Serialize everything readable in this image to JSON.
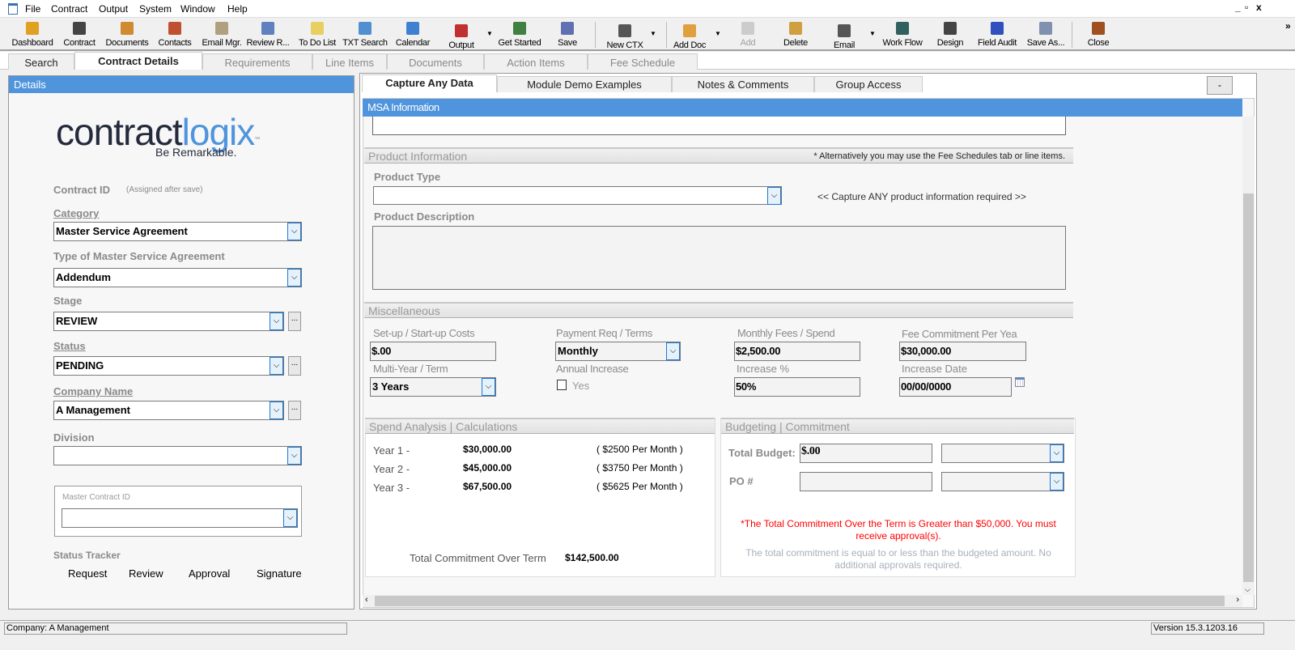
{
  "menu": [
    "File",
    "Contract",
    "Output",
    "System",
    "Window",
    "Help"
  ],
  "window_controls": {
    "minimize": "_",
    "restore": "▫",
    "close": "x",
    "overflow": "»"
  },
  "toolbar": [
    {
      "label": "Dashboard",
      "icon": "dashboard-icon",
      "color": "#e0a020"
    },
    {
      "label": "Contract",
      "icon": "contract-icon",
      "color": "#444"
    },
    {
      "label": "Documents",
      "icon": "documents-icon",
      "color": "#d08a30"
    },
    {
      "label": "Contacts",
      "icon": "contacts-icon",
      "color": "#c05030"
    },
    {
      "label": "Email Mgr.",
      "icon": "email-manager-icon",
      "color": "#b0a080"
    },
    {
      "label": "Review R...",
      "icon": "review-icon",
      "color": "#6080c0"
    },
    {
      "label": "To Do List",
      "icon": "todo-list-icon",
      "color": "#e8d060"
    },
    {
      "label": "TXT Search",
      "icon": "txt-search-icon",
      "color": "#5090d0"
    },
    {
      "label": "Calendar",
      "icon": "calendar-icon",
      "color": "#4080d0"
    },
    {
      "label": "Output",
      "icon": "output-icon",
      "color": "#c03030",
      "dropdown": true
    },
    {
      "label": "Get Started",
      "icon": "flag-icon",
      "color": "#408040"
    },
    {
      "label": "Save",
      "icon": "save-icon",
      "color": "#6070b0"
    },
    {
      "label": "New CTX",
      "icon": "new-ctx-icon",
      "color": "#555",
      "dropdown": true
    },
    {
      "label": "Add Doc",
      "icon": "add-doc-icon",
      "color": "#e0a040",
      "dropdown": true
    },
    {
      "label": "Add",
      "icon": "add-icon",
      "color": "#ccc",
      "disabled": true
    },
    {
      "label": "Delete",
      "icon": "delete-icon",
      "color": "#d0a040"
    },
    {
      "label": "Email",
      "icon": "email-icon",
      "color": "#555",
      "dropdown": true
    },
    {
      "label": "Work Flow",
      "icon": "workflow-icon",
      "color": "#306060"
    },
    {
      "label": "Design",
      "icon": "design-icon",
      "color": "#444"
    },
    {
      "label": "Field Audit",
      "icon": "field-audit-icon",
      "color": "#3050c0"
    },
    {
      "label": "Save As...",
      "icon": "save-as-icon",
      "color": "#8090b0"
    },
    {
      "label": "Close",
      "icon": "close-door-icon",
      "color": "#a05020"
    }
  ],
  "main_tabs": [
    "Search",
    "Contract Details",
    "Requirements",
    "Line Items",
    "Documents",
    "Action Items",
    "Fee Schedule"
  ],
  "left": {
    "header": "Details",
    "logo": {
      "part1": "contract",
      "part2": "logix",
      "tagline": "Be Remarkable.",
      "tm": "™"
    },
    "contract_id_label": "Contract ID",
    "contract_id_note": "(Assigned after save)",
    "category_label": "Category",
    "category": "Master Service Agreement",
    "type_label": "Type of Master Service Agreement",
    "type": "Addendum",
    "stage_label": "Stage",
    "stage": "REVIEW",
    "status_label": "Status",
    "status": "PENDING",
    "company_label": "Company Name",
    "company": "A Management",
    "division_label": "Division",
    "division": "",
    "master_label": "Master Contract ID",
    "master": "",
    "tracker_label": "Status Tracker",
    "tracker": [
      "Request",
      "Review",
      "Approval",
      "Signature"
    ],
    "dots": "..."
  },
  "right": {
    "tabs": [
      "Capture Any Data",
      "Module Demo Examples",
      "Notes & Comments",
      "Group Access"
    ],
    "collapse_btn": "-",
    "msa_header": "MSA Information",
    "product": {
      "title": "Product Information",
      "note": "* Alternatively you may use the Fee Schedules tab or line items.",
      "type_label": "Product Type",
      "type": "",
      "hint": "<< Capture ANY product information required >>",
      "desc_label": "Product Description"
    },
    "misc": {
      "title": "Miscellaneous",
      "setup_label": "Set-up / Start-up Costs",
      "setup": "$.00",
      "payment_label": "Payment Req / Terms",
      "payment": "Monthly",
      "monthly_label": "Monthly Fees / Spend",
      "monthly": "$2,500.00",
      "fee_label": "Fee Commitment Per Yea",
      "fee": "$30,000.00",
      "term_label": "Multi-Year / Term",
      "term": "3 Years",
      "annual_label": "Annual Increase",
      "annual_yes": "Yes",
      "annual_checked": false,
      "inc_label": "Increase %",
      "inc": "50%",
      "date_label": "Increase Date",
      "date": "00/00/0000"
    },
    "spend": {
      "title": "Spend Analysis | Calculations",
      "rows": [
        {
          "year": "Year 1 -",
          "amount": "$30,000.00",
          "per": "( $2500 Per Month )"
        },
        {
          "year": "Year 2 -",
          "amount": "$45,000.00",
          "per": "( $3750 Per Month )"
        },
        {
          "year": "Year 3 -",
          "amount": "$67,500.00",
          "per": "( $5625 Per Month )"
        }
      ],
      "total_label": "Total Commitment Over Term",
      "total": "$142,500.00"
    },
    "budget": {
      "title": "Budgeting | Commitment",
      "total_label": "Total Budget:",
      "total": "$.00",
      "po_label": "PO #",
      "po": "",
      "warning": "*The Total Commitment Over the Term is Greater than $50,000. You must receive approval(s).",
      "info": "The total commitment is equal to or less than the budgeted amount. No additional approvals required."
    }
  },
  "statusbar": {
    "company": "Company: A Management",
    "version": "Version 15.3.1203.16"
  },
  "colors": {
    "accent": "#4f94dc",
    "warning": "#ff0000",
    "logo_dark": "#252b3d",
    "logo_blue": "#4f94dc"
  }
}
